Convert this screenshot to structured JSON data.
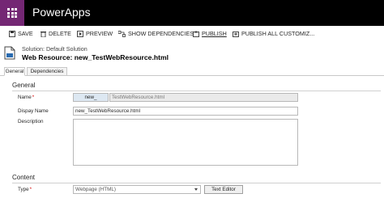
{
  "app": {
    "title": "PowerApps"
  },
  "toolbar": {
    "items": [
      {
        "label": "SAVE",
        "icon": "save-icon"
      },
      {
        "label": "DELETE",
        "icon": "trash-icon"
      },
      {
        "label": "PREVIEW",
        "icon": "preview-icon"
      },
      {
        "label": "SHOW DEPENDENCIES",
        "icon": "dependencies-icon"
      },
      {
        "label": "PUBLISH",
        "icon": "publish-icon"
      },
      {
        "label": "PUBLISH ALL CUSTOMIZ...",
        "icon": "publish-all-icon"
      }
    ]
  },
  "header": {
    "solution": "Solution: Default Solution",
    "title": "Web Resource: new_TestWebResource.html"
  },
  "tabs": [
    {
      "label": "General"
    },
    {
      "label": "Dependencies"
    }
  ],
  "general": {
    "heading": "General",
    "name_label": "Name",
    "name_prefix": "new_",
    "name_value": "TestWebResource.html",
    "display_name_label": "Dispay Name",
    "display_name_value": "new_TestWebResource.html",
    "description_label": "Description",
    "description_value": ""
  },
  "content": {
    "heading": "Content",
    "type_label": "Type",
    "type_value": "Webpage (HTML)",
    "text_editor_button": "Text Editor"
  },
  "colors": {
    "topbar": "#000000",
    "waffle": "#742774",
    "required": "#d40000"
  }
}
